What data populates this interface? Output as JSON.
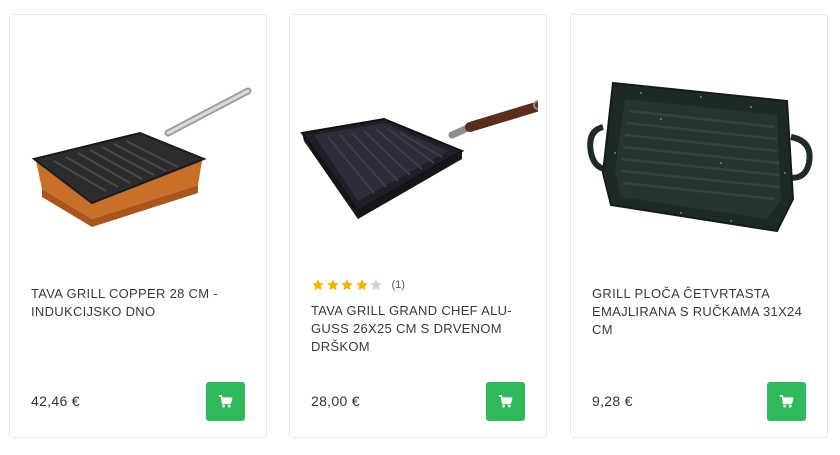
{
  "colors": {
    "accent_green": "#2fb95b",
    "star_filled": "#f5b301",
    "star_empty": "#d0d0d0",
    "card_border": "#e6e6e6"
  },
  "products": [
    {
      "image": "copper-grill-pan",
      "title": "TAVA GRILL COPPER 28 CM - INDUKCIJSKO DNO",
      "price": "42,46 €",
      "cart_icon": "shopping-cart-icon"
    },
    {
      "image": "grand-chef-grill-pan-wooden-handle",
      "rating": {
        "stars": 4,
        "max": 5,
        "count_label": "(1)"
      },
      "title": "TAVA GRILL GRAND CHEF ALU-GUSS 26x25 CM S DRVENOM DRŠKOM",
      "price": "28,00 €",
      "cart_icon": "shopping-cart-icon"
    },
    {
      "image": "enamel-grill-plate-with-handles",
      "title": "GRILL PLOČA ČETVRTASTA EMAJLIRANA S RUČKAMA 31x24 CM",
      "price": "9,28 €",
      "cart_icon": "shopping-cart-icon"
    }
  ]
}
